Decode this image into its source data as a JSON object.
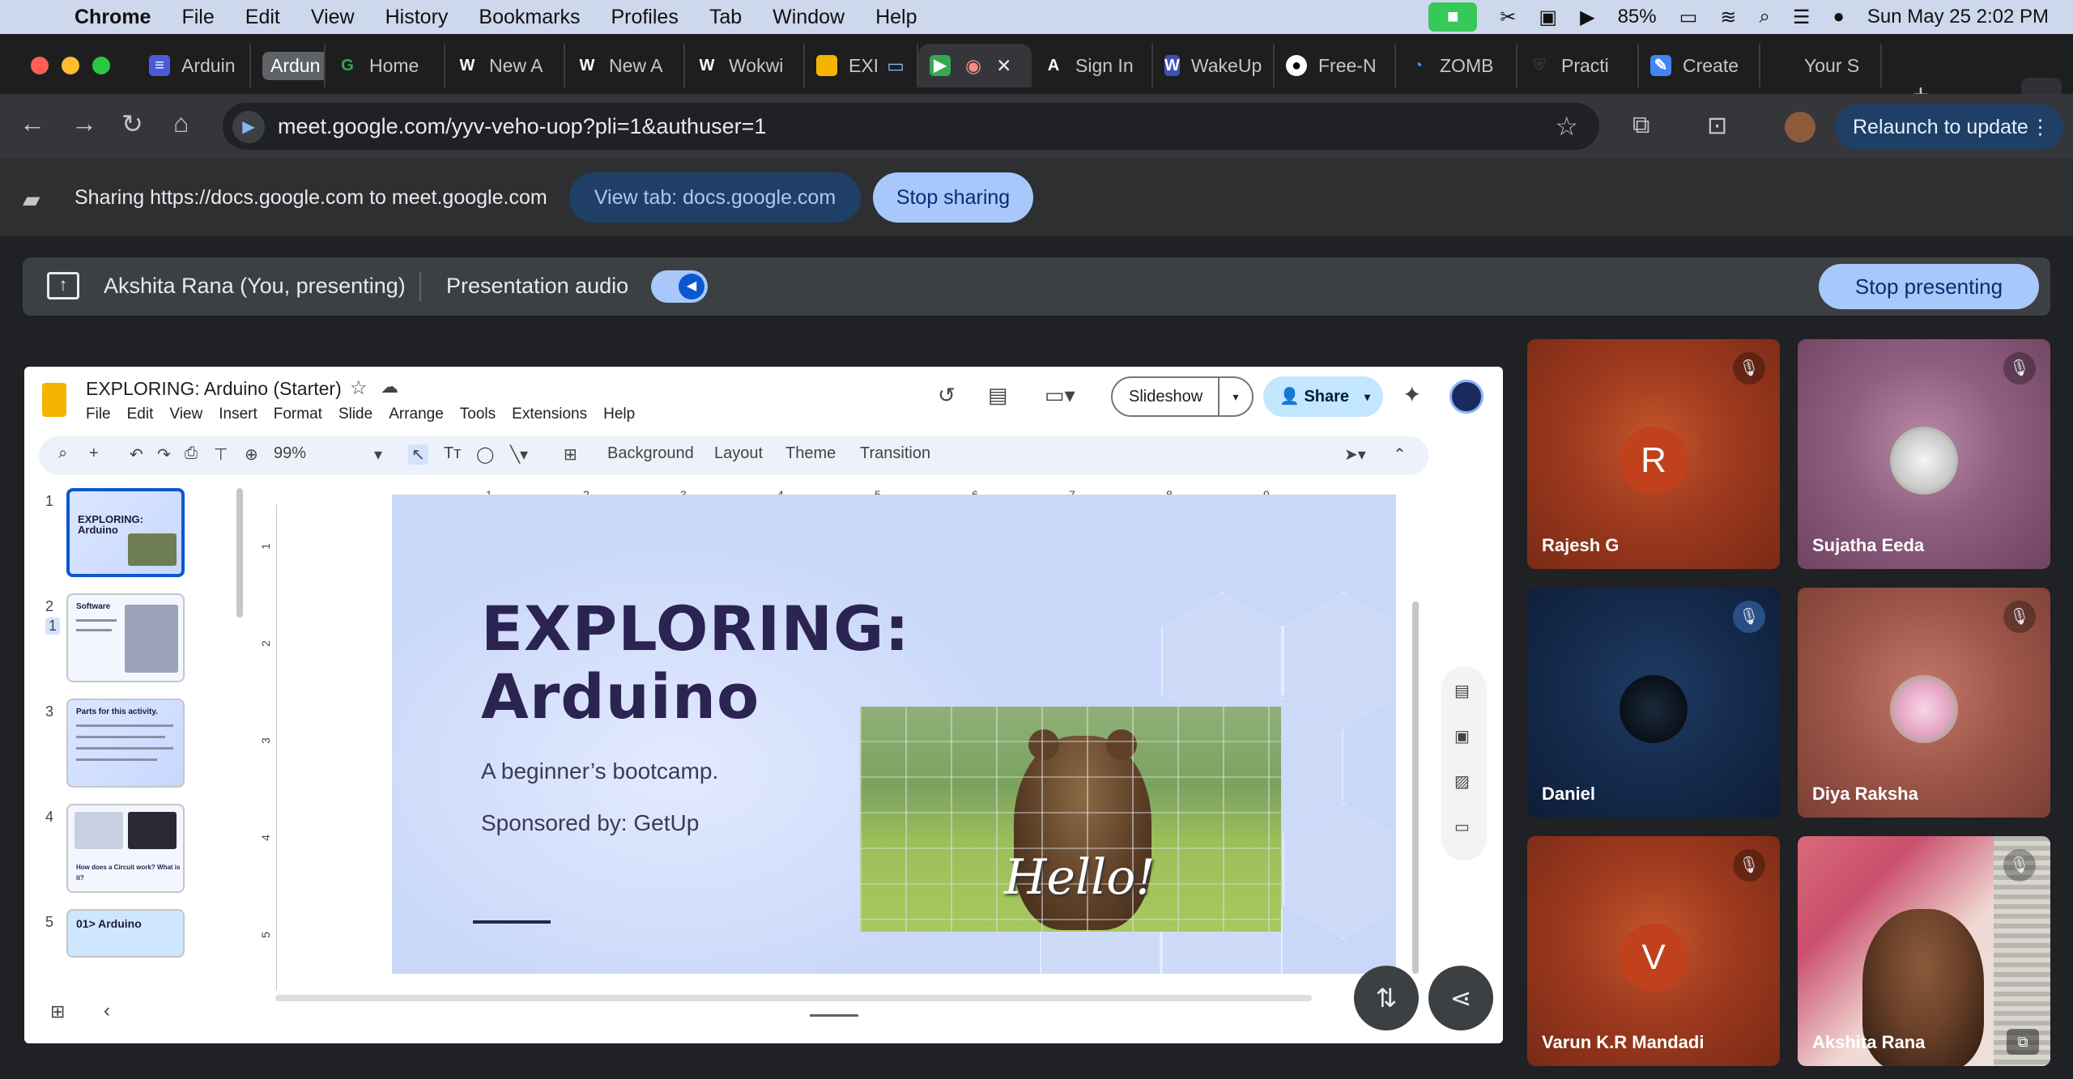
{
  "menubar": {
    "app": "Chrome",
    "items": [
      "File",
      "Edit",
      "View",
      "History",
      "Bookmarks",
      "Profiles",
      "Tab",
      "Window",
      "Help"
    ],
    "battery": "85%",
    "datetime": "Sun May 25  2:02 PM"
  },
  "tabs": [
    {
      "label": "Arduin",
      "icon": "slides-icon"
    },
    {
      "label": "Ardun",
      "icon": "group-pill"
    },
    {
      "label": "Home",
      "icon": "g-icon"
    },
    {
      "label": "New A",
      "icon": "w-icon"
    },
    {
      "label": "New A",
      "icon": "w-icon"
    },
    {
      "label": "Wokwi",
      "icon": "w-icon"
    },
    {
      "label": "EXI",
      "icon": "slides-icon"
    },
    {
      "label": "",
      "icon": "meet-icon"
    },
    {
      "label": "Sign In",
      "icon": "a-icon"
    },
    {
      "label": "WakeUp",
      "icon": "wake-icon"
    },
    {
      "label": "Free-N",
      "icon": "github-icon"
    },
    {
      "label": "ZOMB",
      "icon": "zomb-icon"
    },
    {
      "label": "Practi",
      "icon": "shield-icon"
    },
    {
      "label": "Create",
      "icon": "create-icon"
    },
    {
      "label": "Your S",
      "icon": "blank-icon"
    }
  ],
  "toolbar": {
    "url": "meet.google.com/yyv-veho-uop?pli=1&authuser=1",
    "relaunch": "Relaunch to update"
  },
  "sharebar": {
    "text": "Sharing https://docs.google.com to meet.google.com",
    "view_tab": "View tab: docs.google.com",
    "stop_sharing": "Stop sharing"
  },
  "presbar": {
    "presenter": "Akshita Rana (You, presenting)",
    "audio": "Presentation audio",
    "stop_presenting": "Stop presenting"
  },
  "slides_app": {
    "doc_title": "EXPLORING: Arduino (Starter)",
    "menu": [
      "File",
      "Edit",
      "View",
      "Insert",
      "Format",
      "Slide",
      "Arrange",
      "Tools",
      "Extensions",
      "Help"
    ],
    "slideshow": "Slideshow",
    "share": "Share",
    "zoom": "99%",
    "toolbar_items": [
      "Background",
      "Layout",
      "Theme",
      "Transition"
    ],
    "ruler_ticks": [
      "1",
      "2",
      "3",
      "4",
      "5",
      "6",
      "7",
      "8",
      "9"
    ],
    "vruler_ticks": [
      "1",
      "2",
      "3",
      "4",
      "5"
    ],
    "thumbnails": [
      {
        "num": "1",
        "title": "EXPLORING: Arduino"
      },
      {
        "num": "2",
        "title": "Software"
      },
      {
        "num": "3",
        "title": "Parts for this activity."
      },
      {
        "num": "4",
        "title": "How does a Circuit work? What is it?"
      },
      {
        "num": "5",
        "title": "01>  Arduino"
      }
    ],
    "thumb2_badge": "1",
    "slide": {
      "title_line1": "EXPLORING:",
      "title_line2": "Arduino",
      "subtitle": "A beginner’s bootcamp.",
      "sponsor": "Sponsored by: GetUp",
      "image_caption": "Hello!"
    }
  },
  "participants": [
    {
      "name": "Rajesh G",
      "initial": "R",
      "muted": true
    },
    {
      "name": "Sujatha Eeda",
      "initial": "",
      "muted": true
    },
    {
      "name": "Daniel",
      "initial": "",
      "muted": true
    },
    {
      "name": "Diya Raksha",
      "initial": "",
      "muted": true
    },
    {
      "name": "Varun K.R Mandadi",
      "initial": "V",
      "muted": true
    },
    {
      "name": "Akshita Rana",
      "initial": "",
      "muted": true
    }
  ],
  "colors": {
    "meet_bg": "#202124",
    "accent_blue": "#a8c7fa",
    "slide_title": "#2b2352"
  }
}
